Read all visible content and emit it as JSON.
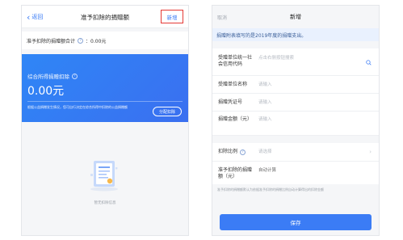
{
  "left": {
    "nav": {
      "back": "返回",
      "title": "准予扣除的捐赠额",
      "add": "新增"
    },
    "total": {
      "label": "准予扣除的捐赠额合计",
      "value": "0.00元"
    },
    "card": {
      "label": "综合所得捐赠扣除",
      "amount": "0.00元",
      "note": "根据公益捐赠发生情况，您可自行决定在综合所得中扣除的公益捐赠额",
      "distribute": "分配扣除"
    },
    "empty": {
      "text": "暂无扣除信息"
    }
  },
  "right": {
    "nav": {
      "cancel": "取消",
      "title": "新增"
    },
    "hint": "捐赠附表填写的是2019年度的捐赠支出。",
    "form": {
      "unit_code": {
        "label": "受赠单位统一社会信用代码",
        "placeholder": "点击右侧按钮搜索"
      },
      "unit_name": {
        "label": "受赠单位名称",
        "placeholder": "请输入"
      },
      "voucher": {
        "label": "捐赠凭证号",
        "placeholder": "请输入"
      },
      "amount": {
        "label": "捐赠金额（元）",
        "placeholder": "请输入"
      },
      "ratio": {
        "label": "扣除比例",
        "placeholder": "请选择"
      },
      "deductible": {
        "label": "准予扣除的捐赠额（元）",
        "value": "自动计算"
      }
    },
    "foot_note": "准予扣除的捐赠额默认为依据准予扣除的捐赠比例自动计算得出的扣除金额",
    "save": "保存"
  },
  "colors": {
    "primary": "#3b7cf5",
    "highlight": "#e53935"
  }
}
